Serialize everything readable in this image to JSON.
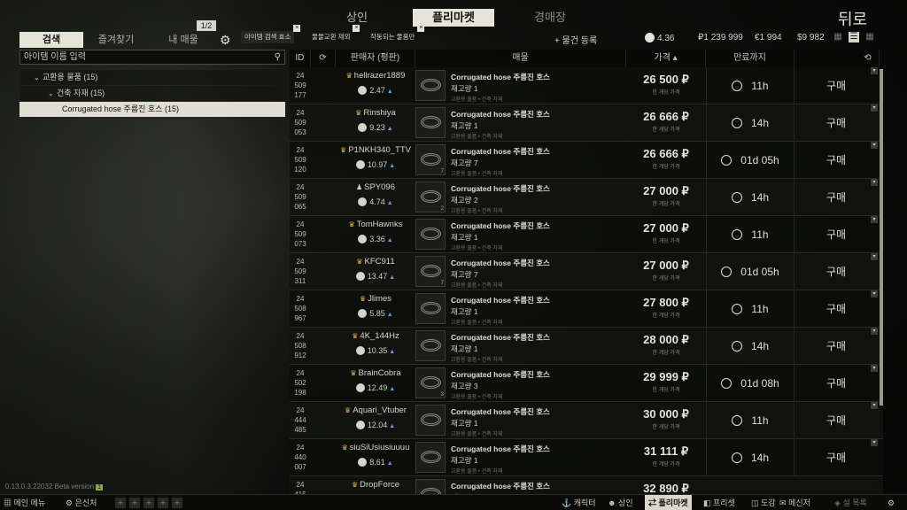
{
  "nav": {
    "traders": "상인",
    "flea": "플리마켓",
    "auction": "경매장",
    "back": "뒤로"
  },
  "subnav": {
    "search": "검색",
    "favorites": "즐겨찾기",
    "my_offers": "내 매물",
    "page": "1/2"
  },
  "filters": {
    "chip1": "아이템 검색 효소",
    "chip2": "물물교환 제외",
    "chip3": "작동되는 물품만"
  },
  "toolbar": {
    "add_offer": "+ 물건 등록",
    "rep": "4.36",
    "rub": "₽1 239 999",
    "eur": "€1 994",
    "usd": "$9 982"
  },
  "search": {
    "placeholder": "아이템 이름 입력"
  },
  "tree": [
    {
      "label": "교환용 물품 (15)",
      "level": 1
    },
    {
      "label": "건축 자재 (15)",
      "level": 2
    },
    {
      "label": "Corrugated hose 주름진 호스 (15)",
      "level": 3
    }
  ],
  "version": "0.13.0.3.22032 Beta version",
  "version_tag": "1",
  "table": {
    "headers": {
      "id": "ID",
      "seller": "판매자 (평판)",
      "item": "매물",
      "price": "가격 ▴",
      "expiry": "만료까지"
    },
    "rows": [
      {
        "id1": "24",
        "id2": "509",
        "id3": "177",
        "seller": "hellrazer1889",
        "badge": "crown",
        "rating": "2.47",
        "item": "Corrugated hose 주름진 호스",
        "qty": "재고량 1",
        "stack": "",
        "category": "교환용 물품 • 건축 자재",
        "price": "26 500 ₽",
        "price_sub": "한 개당 가격",
        "expiry": "11h",
        "buy": "구매"
      },
      {
        "id1": "24",
        "id2": "509",
        "id3": "053",
        "seller": "Rinshiya",
        "badge": "crown",
        "rating": "9.23",
        "item": "Corrugated hose 주름진 호스",
        "qty": "재고량 1",
        "stack": "",
        "category": "교환용 물품 • 건축 자재",
        "price": "26 666 ₽",
        "price_sub": "한 개당 가격",
        "expiry": "14h",
        "buy": "구매"
      },
      {
        "id1": "24",
        "id2": "509",
        "id3": "120",
        "seller": "P1NKH340_TTV",
        "badge": "crown",
        "rating": "10.97",
        "item": "Corrugated hose 주름진 호스",
        "qty": "재고량 7",
        "stack": "7",
        "category": "교환용 물품 • 건축 자재",
        "price": "26 666 ₽",
        "price_sub": "한 개당 가격",
        "expiry": "01d 05h",
        "buy": "구매"
      },
      {
        "id1": "24",
        "id2": "509",
        "id3": "065",
        "seller": "SPY096",
        "badge": "person",
        "rating": "4.74",
        "item": "Corrugated hose 주름진 호스",
        "qty": "재고량 2",
        "stack": "2",
        "category": "교환용 물품 • 건축 자재",
        "price": "27 000 ₽",
        "price_sub": "한 개당 가격",
        "expiry": "14h",
        "buy": "구매"
      },
      {
        "id1": "24",
        "id2": "509",
        "id3": "073",
        "seller": "TomHawnks",
        "badge": "crown",
        "rating": "3.36",
        "item": "Corrugated hose 주름진 호스",
        "qty": "재고량 1",
        "stack": "",
        "category": "교환용 물품 • 건축 자재",
        "price": "27 000 ₽",
        "price_sub": "한 개당 가격",
        "expiry": "11h",
        "buy": "구매"
      },
      {
        "id1": "24",
        "id2": "509",
        "id3": "311",
        "seller": "KFC911",
        "badge": "crown",
        "rating": "13.47",
        "item": "Corrugated hose 주름진 호스",
        "qty": "재고량 7",
        "stack": "7",
        "category": "교환용 물품 • 건축 자재",
        "price": "27 000 ₽",
        "price_sub": "한 개당 가격",
        "expiry": "01d 05h",
        "buy": "구매"
      },
      {
        "id1": "24",
        "id2": "508",
        "id3": "967",
        "seller": "Jlimes",
        "badge": "crown",
        "rating": "5.85",
        "item": "Corrugated hose 주름진 호스",
        "qty": "재고량 1",
        "stack": "",
        "category": "교환용 물품 • 건축 자재",
        "price": "27 800 ₽",
        "price_sub": "한 개당 가격",
        "expiry": "11h",
        "buy": "구매"
      },
      {
        "id1": "24",
        "id2": "508",
        "id3": "912",
        "seller": "4K_144Hz",
        "badge": "crown",
        "rating": "10.35",
        "item": "Corrugated hose 주름진 호스",
        "qty": "재고량 1",
        "stack": "",
        "category": "교환용 물품 • 건축 자재",
        "price": "28 000 ₽",
        "price_sub": "한 개당 가격",
        "expiry": "14h",
        "buy": "구매"
      },
      {
        "id1": "24",
        "id2": "502",
        "id3": "198",
        "seller": "BrainCobra",
        "badge": "crown",
        "rating": "12.49",
        "item": "Corrugated hose 주름진 호스",
        "qty": "재고량 3",
        "stack": "3",
        "category": "교환용 물품 • 건축 자재",
        "price": "29 999 ₽",
        "price_sub": "한 개당 가격",
        "expiry": "01d 08h",
        "buy": "구매"
      },
      {
        "id1": "24",
        "id2": "444",
        "id3": "485",
        "seller": "Aquari_Vtuber",
        "badge": "crown",
        "rating": "12.04",
        "item": "Corrugated hose 주름진 호스",
        "qty": "재고량 1",
        "stack": "",
        "category": "교환용 물품 • 건축 자재",
        "price": "30 000 ₽",
        "price_sub": "한 개당 가격",
        "expiry": "11h",
        "buy": "구매"
      },
      {
        "id1": "24",
        "id2": "440",
        "id3": "007",
        "seller": "siuSiUsiusiuuuu",
        "badge": "crown",
        "rating": "8.61",
        "item": "Corrugated hose 주름진 호스",
        "qty": "재고량 1",
        "stack": "",
        "category": "교환용 물품 • 건축 자재",
        "price": "31 111 ₽",
        "price_sub": "한 개당 가격",
        "expiry": "14h",
        "buy": "구매"
      },
      {
        "id1": "24",
        "id2": "415",
        "id3": "",
        "seller": "DropForce",
        "badge": "crown",
        "rating": "",
        "item": "Corrugated hose 주름진 호스",
        "qty": "재고량 1",
        "stack": "",
        "category": "",
        "price": "32 890 ₽",
        "price_sub": "",
        "expiry": "",
        "buy": ""
      }
    ]
  },
  "bottombar": {
    "menu": "메인 메뉴",
    "hideout": "은신처",
    "character": "캐릭터",
    "traders": "상인",
    "flea": "플리마켓",
    "builds": "프리셋",
    "handbook": "도감",
    "messenger": "메신저",
    "survey": "설 목록"
  }
}
